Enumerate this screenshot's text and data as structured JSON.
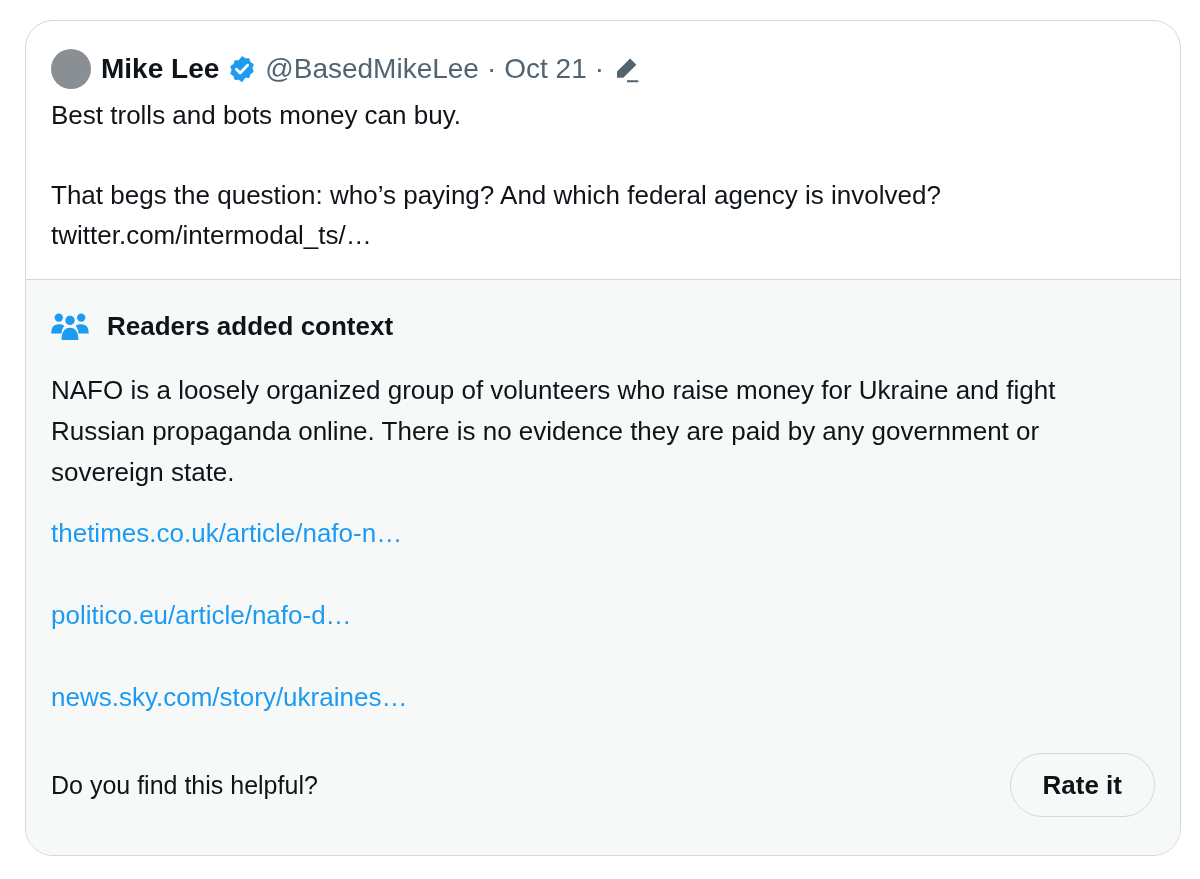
{
  "tweet": {
    "author": {
      "name": "Mike Lee",
      "verified": true,
      "handle": "@BasedMikeLee",
      "separator": "·",
      "date": "Oct 21",
      "separator_2": "·",
      "edited": true
    },
    "text": "Best trolls and bots money can buy.\n\nThat begs the question: who’s paying? And which federal agency is involved?",
    "link": "twitter.com/intermodal_ts/…"
  },
  "community_note": {
    "title": "Readers added context",
    "text": "NAFO is a loosely organized group of volunteers who raise money for Ukraine and fight Russian propaganda online. There is no evidence they are paid by any government or sovereign state.",
    "links": [
      "thetimes.co.uk/article/nafo-n…",
      "politico.eu/article/nafo-d…",
      "news.sky.com/story/ukraines…"
    ],
    "question": "Do you find this helpful?",
    "button": "Rate it"
  }
}
